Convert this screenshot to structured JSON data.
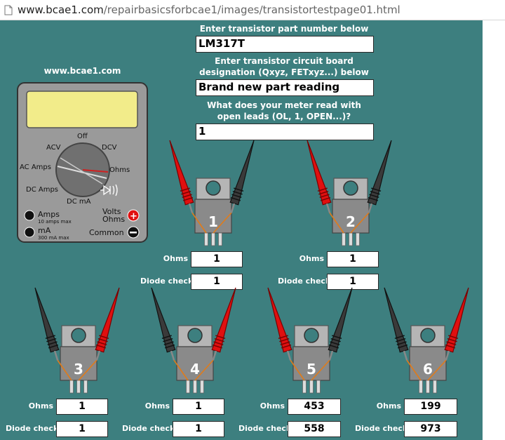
{
  "browser": {
    "url_host": "www.bcae1.com",
    "url_path": "/repairbasicsforbcae1/images/transistortestpage01.html"
  },
  "site_label": "www.bcae1.com",
  "form": {
    "part_number_heading": "Enter transistor part number below",
    "part_number_value": "LM317T",
    "designation_heading_line1": "Enter transistor circuit board",
    "designation_heading_line2": "designation (Qxyz, FETxyz...) below",
    "designation_value": "Brand new part reading",
    "open_leads_heading_line1": "What does your meter read with",
    "open_leads_heading_line2": "open leads (OL, 1, OPEN...)?",
    "open_leads_value": "1"
  },
  "meter": {
    "dial": {
      "off": "Off",
      "acv": "ACV",
      "dcv": "DCV",
      "ac_amps": "AC Amps",
      "ohms": "Ohms",
      "dc_amps": "DC Amps",
      "dc_ma": "DC mA"
    },
    "jacks": {
      "amps": "Amps",
      "amps_sub": "10 amps max",
      "ma": "mA",
      "ma_sub": "300 mA max",
      "volts": "Volts",
      "ohms": "Ohms",
      "common": "Common"
    },
    "colors": {
      "body": "#9a9a9a",
      "display": "#f2ec8a",
      "dial": "#707070"
    }
  },
  "labels": {
    "ohms": "Ohms",
    "diode_check": "Diode check"
  },
  "tests": [
    {
      "number": "1",
      "ohms": "1",
      "diode": "1"
    },
    {
      "number": "2",
      "ohms": "1",
      "diode": "1"
    },
    {
      "number": "3",
      "ohms": "1",
      "diode": "1"
    },
    {
      "number": "4",
      "ohms": "1",
      "diode": "1"
    },
    {
      "number": "5",
      "ohms": "453",
      "diode": "558"
    },
    {
      "number": "6",
      "ohms": "199",
      "diode": "973"
    }
  ],
  "colors": {
    "background": "#3d7f7f",
    "probe_red": "#e01010",
    "probe_black": "#3a3a3a",
    "component_body": "#8a8a8a",
    "component_tab": "#b5b5b5",
    "lead_trace": "#e07b1a"
  }
}
